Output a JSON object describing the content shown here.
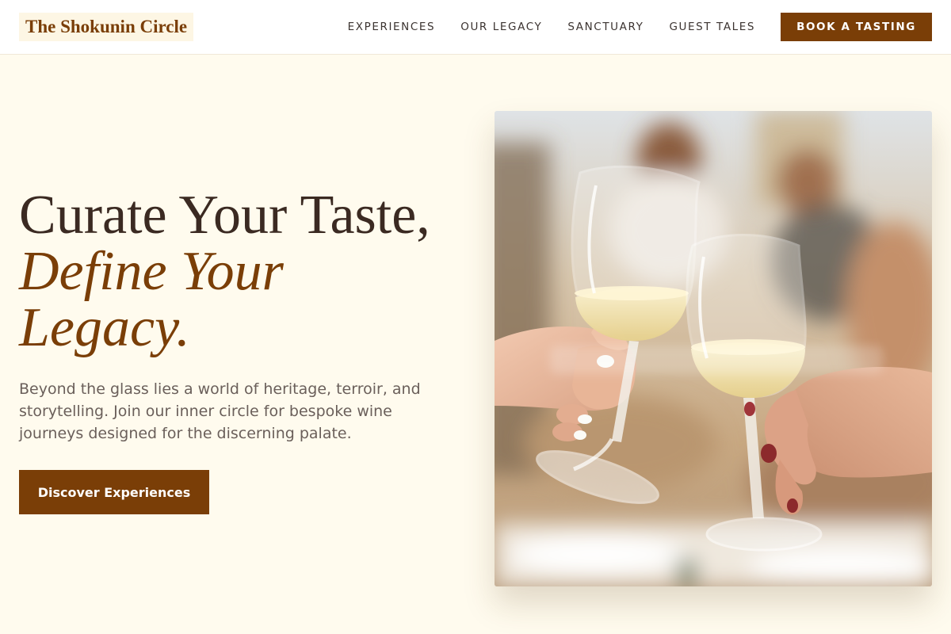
{
  "brand": {
    "name": "The Shokunin Circle"
  },
  "nav": {
    "items": [
      {
        "label": "EXPERIENCES"
      },
      {
        "label": "OUR LEGACY"
      },
      {
        "label": "SANCTUARY"
      },
      {
        "label": "GUEST TALES"
      }
    ],
    "cta_label": "BOOK A TASTING"
  },
  "hero": {
    "headline_line1": "Curate Your Taste,",
    "headline_line2": "Define Your Legacy.",
    "subtext": "Beyond the glass lies a world of heritage, terroir, and storytelling. Join our inner circle for bespoke wine journeys designed for the discerning palate.",
    "cta_label": "Discover Experiences",
    "image_subject": "two-hands-toasting-white-wine-glasses"
  },
  "colors": {
    "accent": "#7a3e07",
    "background": "#fffbee",
    "heading": "#3b2a22",
    "body_text": "#6a5f5a"
  }
}
